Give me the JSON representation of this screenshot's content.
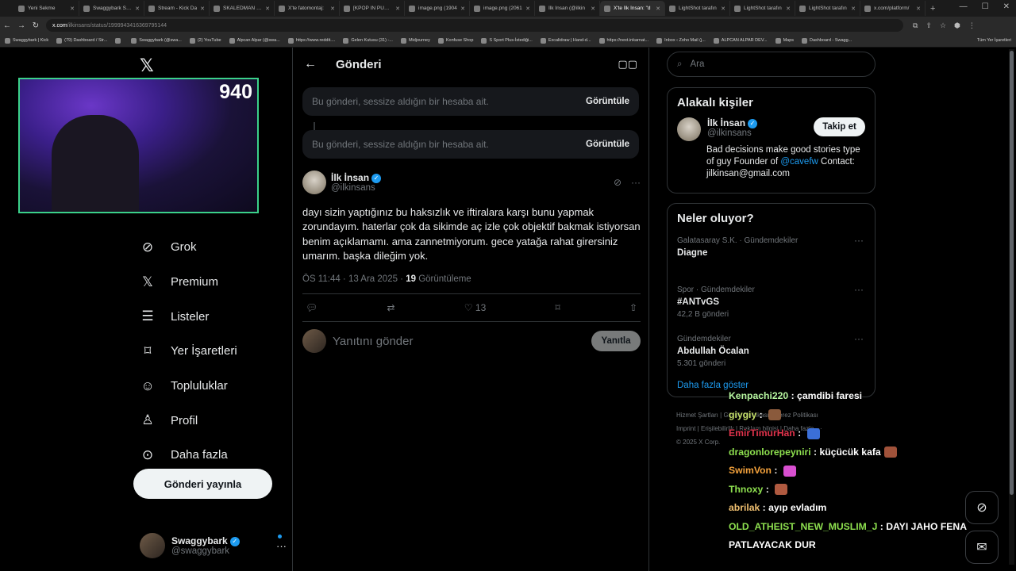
{
  "browser": {
    "tabs": [
      {
        "title": "Yeni Sekme"
      },
      {
        "title": "Swaggybark Stre"
      },
      {
        "title": "Stream - Kick Da"
      },
      {
        "title": "SKALEDMAN (@"
      },
      {
        "title": "X'te fatomontaj:"
      },
      {
        "title": "[KPOP IN PUBLIC"
      },
      {
        "title": "image.png (1904"
      },
      {
        "title": "image.png (2061"
      },
      {
        "title": "İlk İnsan (@ilkin"
      },
      {
        "title": "X'te İlk İnsan: \"d"
      },
      {
        "title": "LightShot tarafın"
      },
      {
        "title": "LightShot tarafın"
      },
      {
        "title": "LightShot tarafın"
      },
      {
        "title": "x.com/platform/"
      }
    ],
    "address": {
      "host": "x.com",
      "path": "/ilkinsans/status/1999943416369795144"
    },
    "bookmarks": [
      "Swaggybark | Kick",
      "(79) Dashboard / Str...",
      "",
      "Swaggybark (@swa...",
      "(2) YouTube",
      "Alpcan Alpar (@swa...",
      "https://www.reddit....",
      "Gelen Kutusu (31) -...",
      "Midjourney",
      "Konfuse Shop",
      "S Sport Plus-İstediği...",
      "Excalidraw | Hand-d...",
      "https://next.inkarnat...",
      "Inbox ‹ Zoho Mail (j...",
      "ALPCAN ALPAR DEV...",
      "Maps",
      "Dashboard - Swagg..."
    ],
    "bookmarks_all": "Tüm Yer İşaretleri"
  },
  "stream": {
    "counter": "940"
  },
  "nav": {
    "items": [
      {
        "label": "Grok",
        "icon": "grok-icon"
      },
      {
        "label": "Premium",
        "icon": "x-icon"
      },
      {
        "label": "Listeler",
        "icon": "list-icon"
      },
      {
        "label": "Yer İşaretleri",
        "icon": "bookmark-icon"
      },
      {
        "label": "Topluluklar",
        "icon": "communities-icon"
      },
      {
        "label": "Profil",
        "icon": "profile-icon"
      },
      {
        "label": "Daha fazla",
        "icon": "more-circle-icon"
      }
    ],
    "post_button": "Gönderi yayınla",
    "account": {
      "name": "Swaggybark",
      "handle": "@swaggybark"
    }
  },
  "main": {
    "title": "Gönderi",
    "muted_notices": [
      {
        "text": "Bu gönderi, sessize aldığın bir hesaba ait.",
        "action": "Görüntüle"
      },
      {
        "text": "Bu gönderi, sessize aldığın bir hesaba ait.",
        "action": "Görüntüle"
      }
    ],
    "tweet": {
      "name": "İlk İnsan",
      "handle": "@ilkinsans",
      "text": "dayı sizin yaptığınız bu haksızlık ve iftiralara karşı bunu yapmak zorundayım. haterlar çok da sikimde aç izle çok objektif bakmak istiyorsan benim açıklamamı. ama zannetmiyorum. gece yatağa rahat girersiniz umarım. başka dileğim yok.",
      "time": "ÖS 11:44 · 13 Ara 2025 ·",
      "views_count": "19",
      "views_label": "Görüntüleme",
      "likes": "13"
    },
    "reply": {
      "placeholder": "Yanıtını gönder",
      "button": "Yanıtla"
    }
  },
  "sidebar": {
    "search_placeholder": "Ara",
    "related": {
      "title": "Alakalı kişiler",
      "name": "İlk İnsan",
      "handle": "@ilkinsans",
      "follow": "Takip et",
      "bio_pre": "Bad decisions make good stories type of guy Founder of",
      "bio_link": "@cavefw",
      "bio_post": "Contact: jilkinsan@gmail.com"
    },
    "trends": {
      "title": "Neler oluyor?",
      "items": [
        {
          "category": "Galatasaray S.K. · Gündemdekiler",
          "name": "Diagne",
          "count": ""
        },
        {
          "category": "Spor · Gündemdekiler",
          "name": "#ANTvGS",
          "count": "42,2 B gönderi"
        },
        {
          "category": "Gündemdekiler",
          "name": "Abdullah Öcalan",
          "count": "5.301 gönderi"
        }
      ],
      "show_more": "Daha fazla göster"
    },
    "footer": [
      "Hizmet Şartları",
      "Gizlilik Politikası",
      "Çerez Politikası",
      "Imprint",
      "Erişilebilirlik",
      "Reklam bilgisi",
      "Daha fazla ···",
      "© 2025 X Corp."
    ]
  },
  "chat": [
    {
      "user": "Kenpachi220",
      "color": "#b7f7a0",
      "msg": "çamdibi faresi",
      "emote": ""
    },
    {
      "user": "giygiy",
      "color": "#c7e26b",
      "msg": "",
      "emote": "#8a5a3c"
    },
    {
      "user": "EmirTimurHan",
      "color": "#e0334c",
      "msg": "",
      "emote": "#3b6fd8"
    },
    {
      "user": "dragonlorepeyniri",
      "color": "#8ee04f",
      "msg": "küçücük kafa",
      "emote": "#a0523a"
    },
    {
      "user": "SwimVon",
      "color": "#f4a23c",
      "msg": "",
      "emote": "#d84fd0"
    },
    {
      "user": "Thnoxy",
      "color": "#8ee04f",
      "msg": "",
      "emote": "#b05a40"
    },
    {
      "user": "abrilak",
      "color": "#f0c070",
      "msg": "ayıp evladım",
      "emote": ""
    },
    {
      "user": "OLD_ATHEIST_NEW_MUSLIM_J",
      "color": "#8ee04f",
      "msg": "DAYI JAHO FENA",
      "emote": ""
    },
    {
      "user": "",
      "color": "#ffffff",
      "msg": "PATLAYACAK DUR",
      "emote": ""
    }
  ]
}
